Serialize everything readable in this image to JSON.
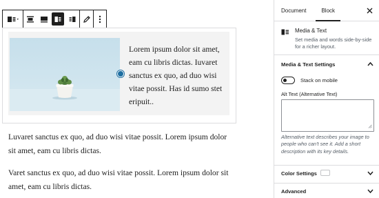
{
  "toolbar": {
    "buttons": [
      "block-type-media-text-icon",
      "align-wide-icon",
      "align-full-icon",
      "media-left-icon",
      "media-right-icon",
      "replace-edit-icon",
      "more-options-icon"
    ]
  },
  "block": {
    "media_text": "Lorem ipsum dolor sit amet, eam cu libris dictas. Iuvaret sanctus ex quo, ad duo wisi vitae possit. Has id sumo stet eripuit.."
  },
  "paragraphs": [
    "Luvaret sanctus ex quo, ad duo wisi vitae possit. Lorem ipsum dolor sit amet, eam cu libris dictas.",
    "Varet sanctus ex quo, ad duo wisi vitae possit. Lorem ipsum dolor sit amet, eam cu libris dictas."
  ],
  "sidebar": {
    "tabs": {
      "document": "Document",
      "block": "Block"
    },
    "block_card": {
      "title": "Media & Text",
      "description": "Set media and words side-by-side for a richer layout."
    },
    "settings_panel": {
      "title": "Media & Text Settings",
      "toggle_label": "Stack on mobile",
      "toggle_on": false,
      "alt_label": "Alt Text (Alternative Text)",
      "alt_value": "",
      "alt_help": "Alternative text describes your image to people who can't see it. Add a short description with its key details."
    },
    "color_panel": {
      "title": "Color Settings"
    },
    "advanced_panel": {
      "title": "Advanced"
    }
  },
  "colors": {
    "accent": "#1e6ea1",
    "text": "#1e1e1e",
    "muted": "#555d66",
    "border": "#dcdcde",
    "media_bg": "#f3f3f3",
    "image_sky": "#c9e2ee"
  }
}
